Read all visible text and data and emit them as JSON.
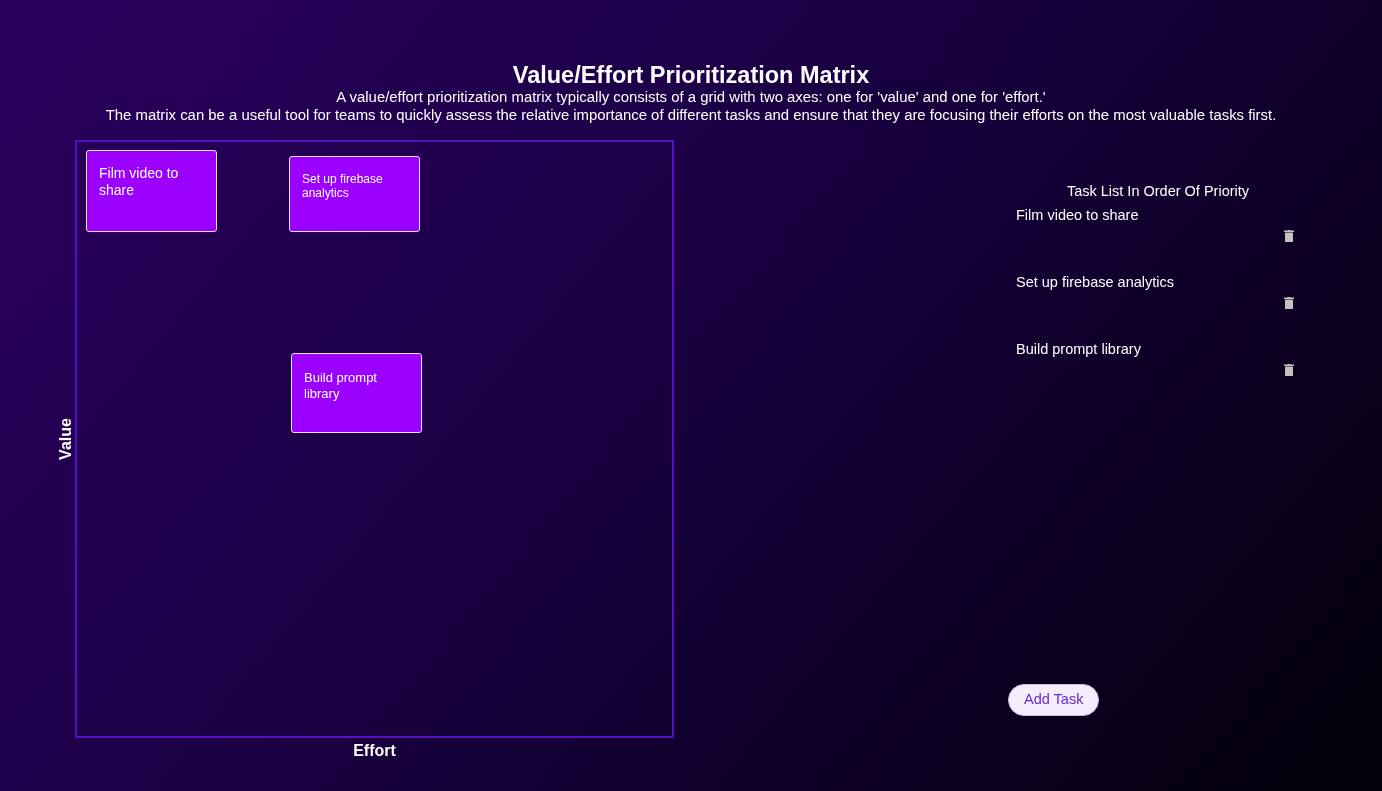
{
  "header": {
    "title": "Value/Effort Prioritization Matrix",
    "description": [
      "A value/effort prioritization matrix typically consists of a grid with two axes: one for 'value' and one for 'effort.'",
      "The matrix can be a useful tool for teams to quickly assess the relative importance of different tasks and ensure that they are focusing their efforts on the most valuable tasks first."
    ]
  },
  "matrix": {
    "y_axis_label": "Value",
    "x_axis_label": "Effort",
    "notes": [
      {
        "text": "Film video to share"
      },
      {
        "text": "Set up firebase analytics"
      },
      {
        "text": "Build prompt library"
      }
    ]
  },
  "task_list": {
    "title": "Task List In Order Of Priority",
    "tasks": [
      {
        "name": "Film video to share"
      },
      {
        "name": "Set up firebase analytics"
      },
      {
        "name": "Build prompt library"
      }
    ],
    "add_button": "Add Task"
  }
}
